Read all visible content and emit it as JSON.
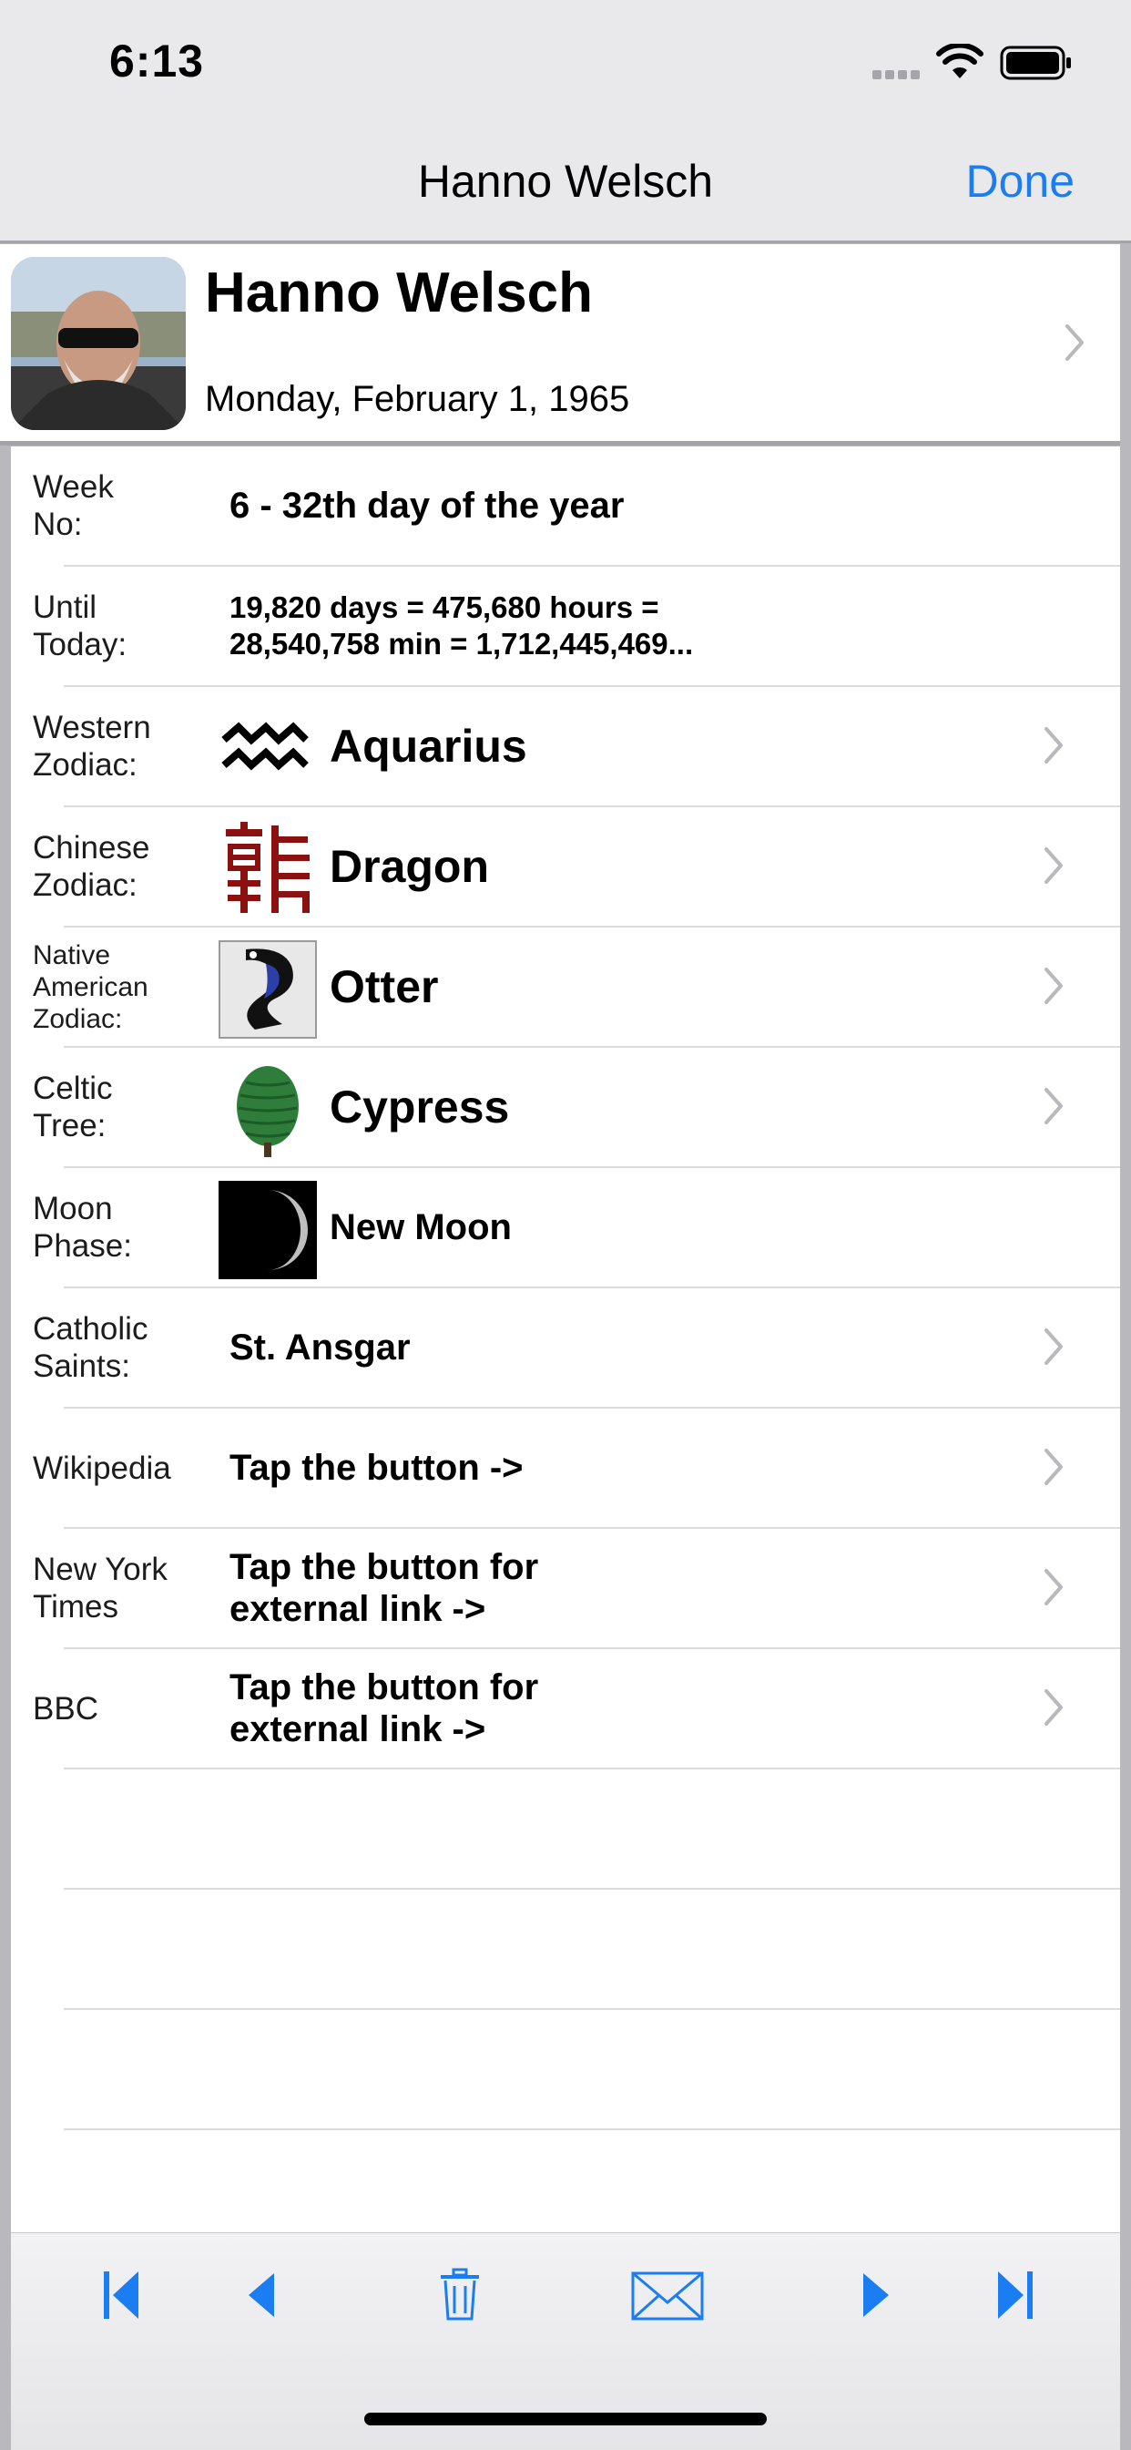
{
  "status": {
    "time": "6:13"
  },
  "nav": {
    "title": "Hanno Welsch",
    "done_label": "Done"
  },
  "header": {
    "name": "Hanno Welsch",
    "date": "Monday, February 1, 1965"
  },
  "rows": [
    {
      "label_1": "Week",
      "label_2": "No:",
      "value": "6 - 32th day of the year"
    },
    {
      "label_1": "Until",
      "label_2": "Today:",
      "value_1": "19,820 days = 475,680 hours =",
      "value_2": "28,540,758 min = 1,712,445,469..."
    },
    {
      "label_1": "Western",
      "label_2": "Zodiac:",
      "value": "Aquarius",
      "icon": "aquarius-icon"
    },
    {
      "label_1": "Chinese",
      "label_2": "Zodiac:",
      "value": "Dragon",
      "icon": "dragon-icon"
    },
    {
      "label_1": "Native",
      "label_2": "American",
      "label_3": "Zodiac:",
      "value": "Otter",
      "icon": "otter-icon"
    },
    {
      "label_1": "Celtic",
      "label_2": "Tree:",
      "value": "Cypress",
      "icon": "cypress-tree-icon"
    },
    {
      "label_1": "Moon",
      "label_2": "Phase:",
      "value": "New Moon",
      "icon": "moon-phase-icon"
    },
    {
      "label_1": "Catholic",
      "label_2": "Saints:",
      "value": "St. Ansgar"
    },
    {
      "label_1": "Wikipedia",
      "value": "Tap the button ->"
    },
    {
      "label_1": "New York",
      "label_2": "Times",
      "value_1": "Tap the button for",
      "value_2": "external link ->"
    },
    {
      "label_1": "BBC",
      "value_1": "Tap the button for",
      "value_2": "external link ->"
    }
  ],
  "toolbar": [
    "first-record-icon",
    "previous-record-icon",
    "trash-icon",
    "mail-icon",
    "next-record-icon",
    "last-record-icon"
  ],
  "colors": {
    "accent": "#1a7ef2",
    "nav_bg": "#e9e9eb",
    "separator": "#dcdcdf"
  }
}
